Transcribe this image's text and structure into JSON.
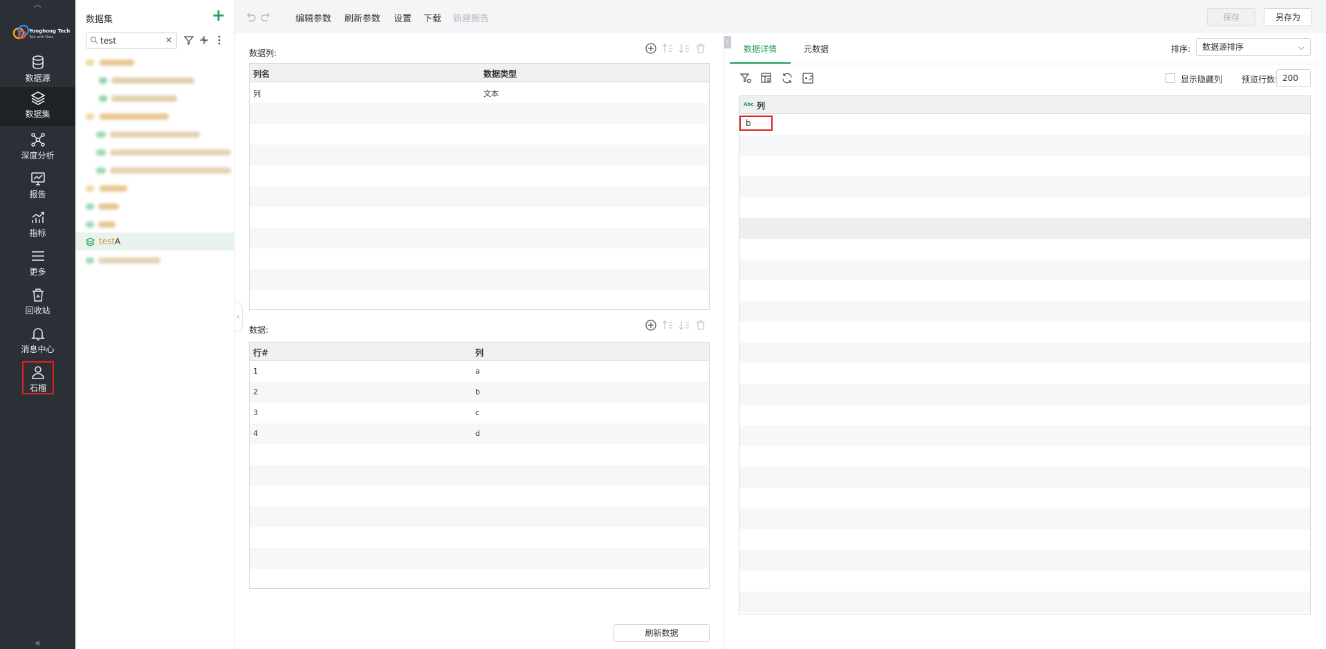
{
  "nav": {
    "logo_line1": "Yonghong Tech",
    "logo_line2": "Talk with Data",
    "items": [
      {
        "label": "数据源",
        "icon": "database-icon"
      },
      {
        "label": "数据集",
        "icon": "layers-icon"
      },
      {
        "label": "深度分析",
        "icon": "network-icon"
      },
      {
        "label": "报告",
        "icon": "report-icon"
      },
      {
        "label": "指标",
        "icon": "metric-icon"
      },
      {
        "label": "更多",
        "icon": "menu-icon"
      },
      {
        "label": "回收站",
        "icon": "recycle-bin-icon"
      },
      {
        "label": "消息中心",
        "icon": "bell-icon"
      },
      {
        "label": "石榴",
        "icon": "user-icon"
      }
    ]
  },
  "tree": {
    "title": "数据集",
    "search_value": "test",
    "selected_item": {
      "prefix": "test",
      "suffix": "A"
    }
  },
  "toolbar": {
    "edit_params": "编辑参数",
    "refresh_params": "刷新参数",
    "settings": "设置",
    "download": "下载",
    "new_report": "新建报告",
    "save": "保存",
    "save_as": "另存为"
  },
  "columns_section": {
    "label": "数据列:",
    "headers": [
      "列名",
      "数据类型"
    ],
    "rows": [
      [
        "列",
        "文本"
      ]
    ]
  },
  "data_section": {
    "label": "数据:",
    "headers": [
      "行#",
      "列"
    ],
    "rows": [
      [
        "1",
        "a"
      ],
      [
        "2",
        "b"
      ],
      [
        "3",
        "c"
      ],
      [
        "4",
        "d"
      ]
    ],
    "refresh_button": "刷新数据"
  },
  "right": {
    "tabs": [
      "数据详情",
      "元数据"
    ],
    "sort_label": "排序:",
    "sort_value": "数据源排序",
    "show_hidden_label": "显示隐藏列",
    "preview_rows_label": "预览行数:",
    "preview_rows_value": "200",
    "grid": {
      "type_badge": "Abc",
      "column_name": "列",
      "first_value": "b"
    }
  },
  "colors": {
    "nav_bg": "#2b3037",
    "accent": "#1f9d55",
    "highlight_red": "#e02020"
  }
}
